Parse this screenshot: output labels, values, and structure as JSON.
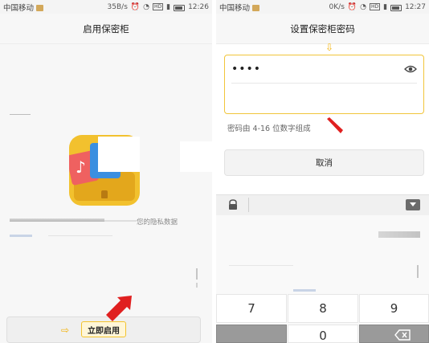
{
  "left": {
    "status": {
      "carrier": "中国移动",
      "speed": "35B/s",
      "time": "12:26"
    },
    "title": "启用保密柜",
    "privacy_text": "您的隐私数据",
    "enable_button": "立即启用"
  },
  "right": {
    "status": {
      "carrier": "中国移动",
      "speed": "0K/s",
      "time": "12:27"
    },
    "title": "设置保密柜密码",
    "password_value": "••••",
    "hint": "密码由 4-16 位数字组成",
    "cancel_button": "取消",
    "keys": [
      "7",
      "8",
      "9",
      "0"
    ]
  },
  "colors": {
    "accent_yellow": "#f3c32e",
    "arrow_red": "#e02020"
  }
}
